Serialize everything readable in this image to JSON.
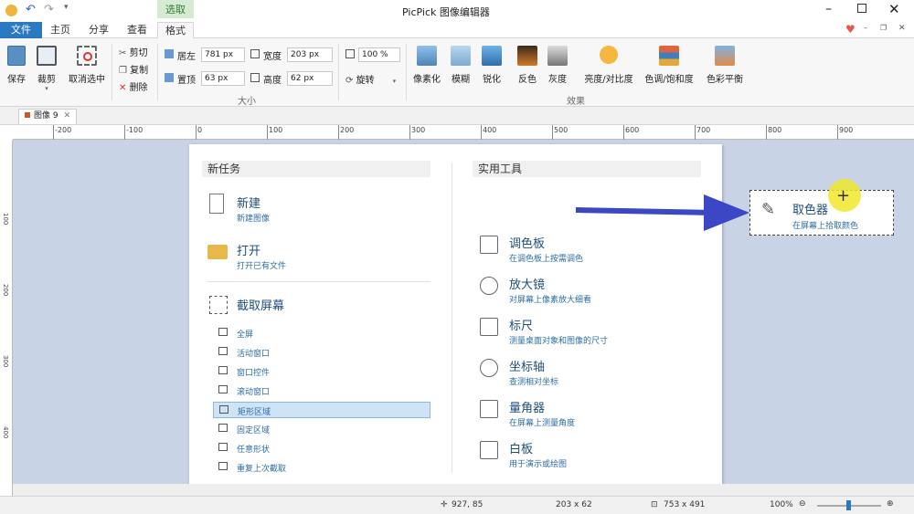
{
  "window": {
    "title": "PicPick 图像编辑器"
  },
  "tabs": {
    "file": "文件",
    "home": "主页",
    "share": "分享",
    "view": "查看",
    "context_group": "选取",
    "format": "格式"
  },
  "ribbon": {
    "save": "保存",
    "crop": "裁剪",
    "deselect": "取消选中",
    "cut": "剪切",
    "copy": "复制",
    "delete": "删除",
    "left_label": "居左",
    "left_value": "781 px",
    "top_label": "置顶",
    "top_value": "63 px",
    "width_label": "宽度",
    "width_value": "203 px",
    "height_label": "高度",
    "height_value": "62 px",
    "size_group": "大小",
    "zoom_value": "100 %",
    "rotate": "旋转",
    "pixelate": "像素化",
    "blur": "模糊",
    "sharpen": "锐化",
    "negative": "反色",
    "grayscale": "灰度",
    "brightness": "亮度/对比度",
    "hue": "色调/饱和度",
    "color_balance": "色彩平衡",
    "effects_group": "效果"
  },
  "doc_tab": {
    "name": "图像 9"
  },
  "ruler_h": [
    "-200",
    "-100",
    "0",
    "100",
    "200",
    "300",
    "400",
    "500",
    "600",
    "700",
    "800",
    "900"
  ],
  "ruler_v": [
    "100",
    "200",
    "300",
    "400"
  ],
  "new_task": {
    "header": "新任务",
    "new_title": "新建",
    "new_sub": "新建图像",
    "open_title": "打开",
    "open_sub": "打开已有文件",
    "capture_title": "截取屏幕",
    "capture_items": [
      "全屏",
      "活动窗口",
      "窗口控件",
      "滚动窗口",
      "矩形区域",
      "固定区域",
      "任意形状",
      "重复上次截取"
    ]
  },
  "tools": {
    "header": "实用工具",
    "items": [
      {
        "title": "调色板",
        "sub": "在调色板上按需调色"
      },
      {
        "title": "放大镜",
        "sub": "对屏幕上像素放大细看"
      },
      {
        "title": "标尺",
        "sub": "测量桌面对象和图像的尺寸"
      },
      {
        "title": "坐标轴",
        "sub": "查测相对坐标"
      },
      {
        "title": "量角器",
        "sub": "在屏幕上测量角度"
      },
      {
        "title": "白板",
        "sub": "用于演示或绘图"
      }
    ]
  },
  "picker": {
    "title": "取色器",
    "sub": "在屏幕上拾取颜色"
  },
  "status": {
    "cursor": "927, 85",
    "selection": "203 x 62",
    "image_size": "753 x 491",
    "zoom": "100%"
  },
  "colors": {
    "accent": "#2b79c2",
    "arrow": "#3b47c4",
    "highlight": "#cfe3f7",
    "cursor": "#f0e82a"
  }
}
